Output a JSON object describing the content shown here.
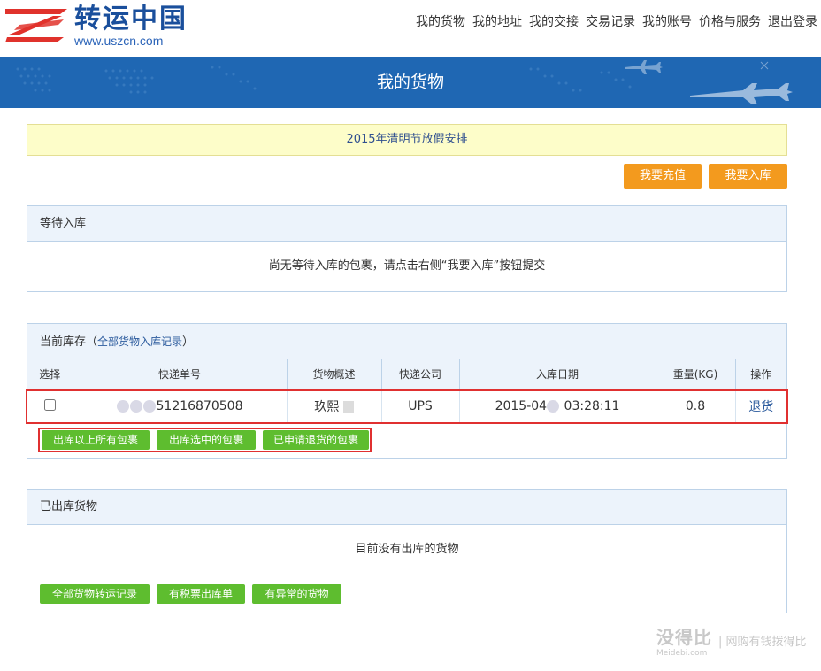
{
  "header": {
    "logo_text": "转运中国",
    "logo_url": "www.uszcn.com",
    "nav": [
      "我的货物",
      "我的地址",
      "我的交接",
      "交易记录",
      "我的账号",
      "价格与服务",
      "退出登录"
    ]
  },
  "banner": {
    "title": "我的货物"
  },
  "notice": {
    "text": "2015年清明节放假安排"
  },
  "actions": {
    "recharge": "我要充值",
    "checkin": "我要入库"
  },
  "waiting": {
    "title": "等待入库",
    "empty_message": "尚无等待入库的包裹，请点击右侧“我要入库”按钮提交"
  },
  "inventory": {
    "title": "当前库存",
    "link_prefix": "（",
    "link": "全部货物入库记录",
    "link_suffix": "）",
    "columns": [
      "选择",
      "快递单号",
      "货物概述",
      "快递公司",
      "入库日期",
      "重量(KG)",
      "操作"
    ],
    "rows": [
      {
        "tracking": "51216870508",
        "desc": "玖熙",
        "carrier": "UPS",
        "date_prefix": "2015-04",
        "date_suffix": "03:28:11",
        "weight": "0.8",
        "action": "退货"
      }
    ],
    "buttons": [
      "出库以上所有包裹",
      "出库选中的包裹",
      "已申请退货的包裹"
    ]
  },
  "shipped": {
    "title": "已出库货物",
    "empty_message": "目前没有出库的货物",
    "buttons": [
      "全部货物转运记录",
      "有税票出库单",
      "有异常的货物"
    ]
  },
  "watermark": {
    "brand": "没得比",
    "domain": "Meidebi.com",
    "slogan": "| 网购有钱拨得比"
  },
  "colors": {
    "banner": "#1f67b3",
    "orange": "#f39a1e",
    "green": "#5ebd2f",
    "link": "#2d5c9e",
    "highlight": "#e03030"
  }
}
